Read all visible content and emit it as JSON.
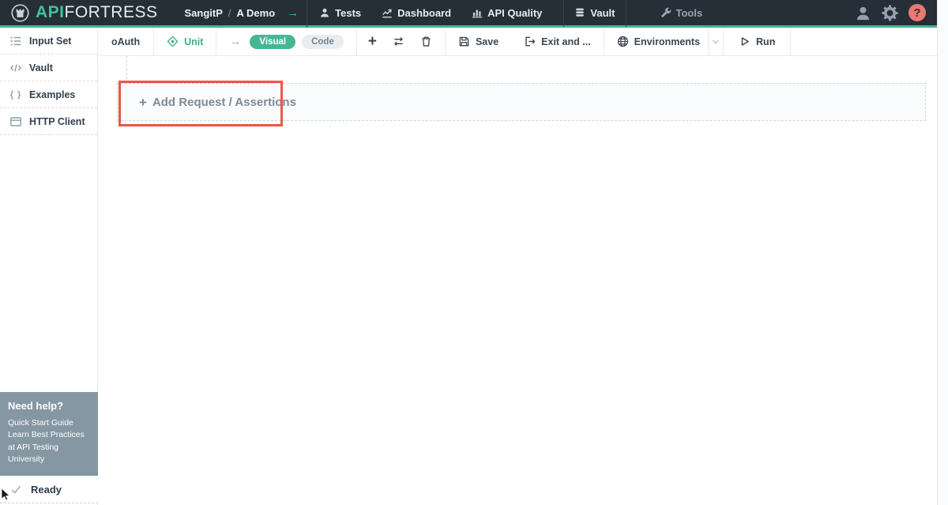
{
  "colors": {
    "accent_teal": "#43b394",
    "navbar_bg": "#262e38",
    "annotation_red": "#e85a42",
    "help_box_bg": "#8597a3",
    "help_badge_bg": "#ea7a71"
  },
  "navbar": {
    "brand": {
      "primary": "API",
      "secondary": "FORTRESS"
    },
    "breadcrumb": {
      "user": "SangitP",
      "separator": "/",
      "project": "A Demo",
      "arrow": "→"
    },
    "items": [
      {
        "label": "Tests"
      },
      {
        "label": "Dashboard"
      },
      {
        "label": "API Quality"
      },
      {
        "label": "Vault"
      },
      {
        "label": "Tools"
      }
    ],
    "help_glyph": "?"
  },
  "toolbar": {
    "oauth_label": "oAuth",
    "unit_label": "Unit",
    "mode_arrow": "→",
    "visual_label": "Visual",
    "code_label": "Code",
    "plus_glyph": "+",
    "save_label": "Save",
    "exit_label": "Exit and ...",
    "environments_label": "Environments",
    "run_label": "Run"
  },
  "sidebar": {
    "items": [
      {
        "label": "Input Set"
      },
      {
        "label": "Vault"
      },
      {
        "label": "Examples"
      },
      {
        "label": "HTTP Client"
      }
    ],
    "braces_glyph": "{ }",
    "help": {
      "title": "Need help?",
      "links": [
        "Quick Start Guide",
        "Learn Best Practices at API Testing University"
      ]
    },
    "status": "Ready"
  },
  "main": {
    "add_plus": "+",
    "add_label": "Add Request / Assertions"
  }
}
